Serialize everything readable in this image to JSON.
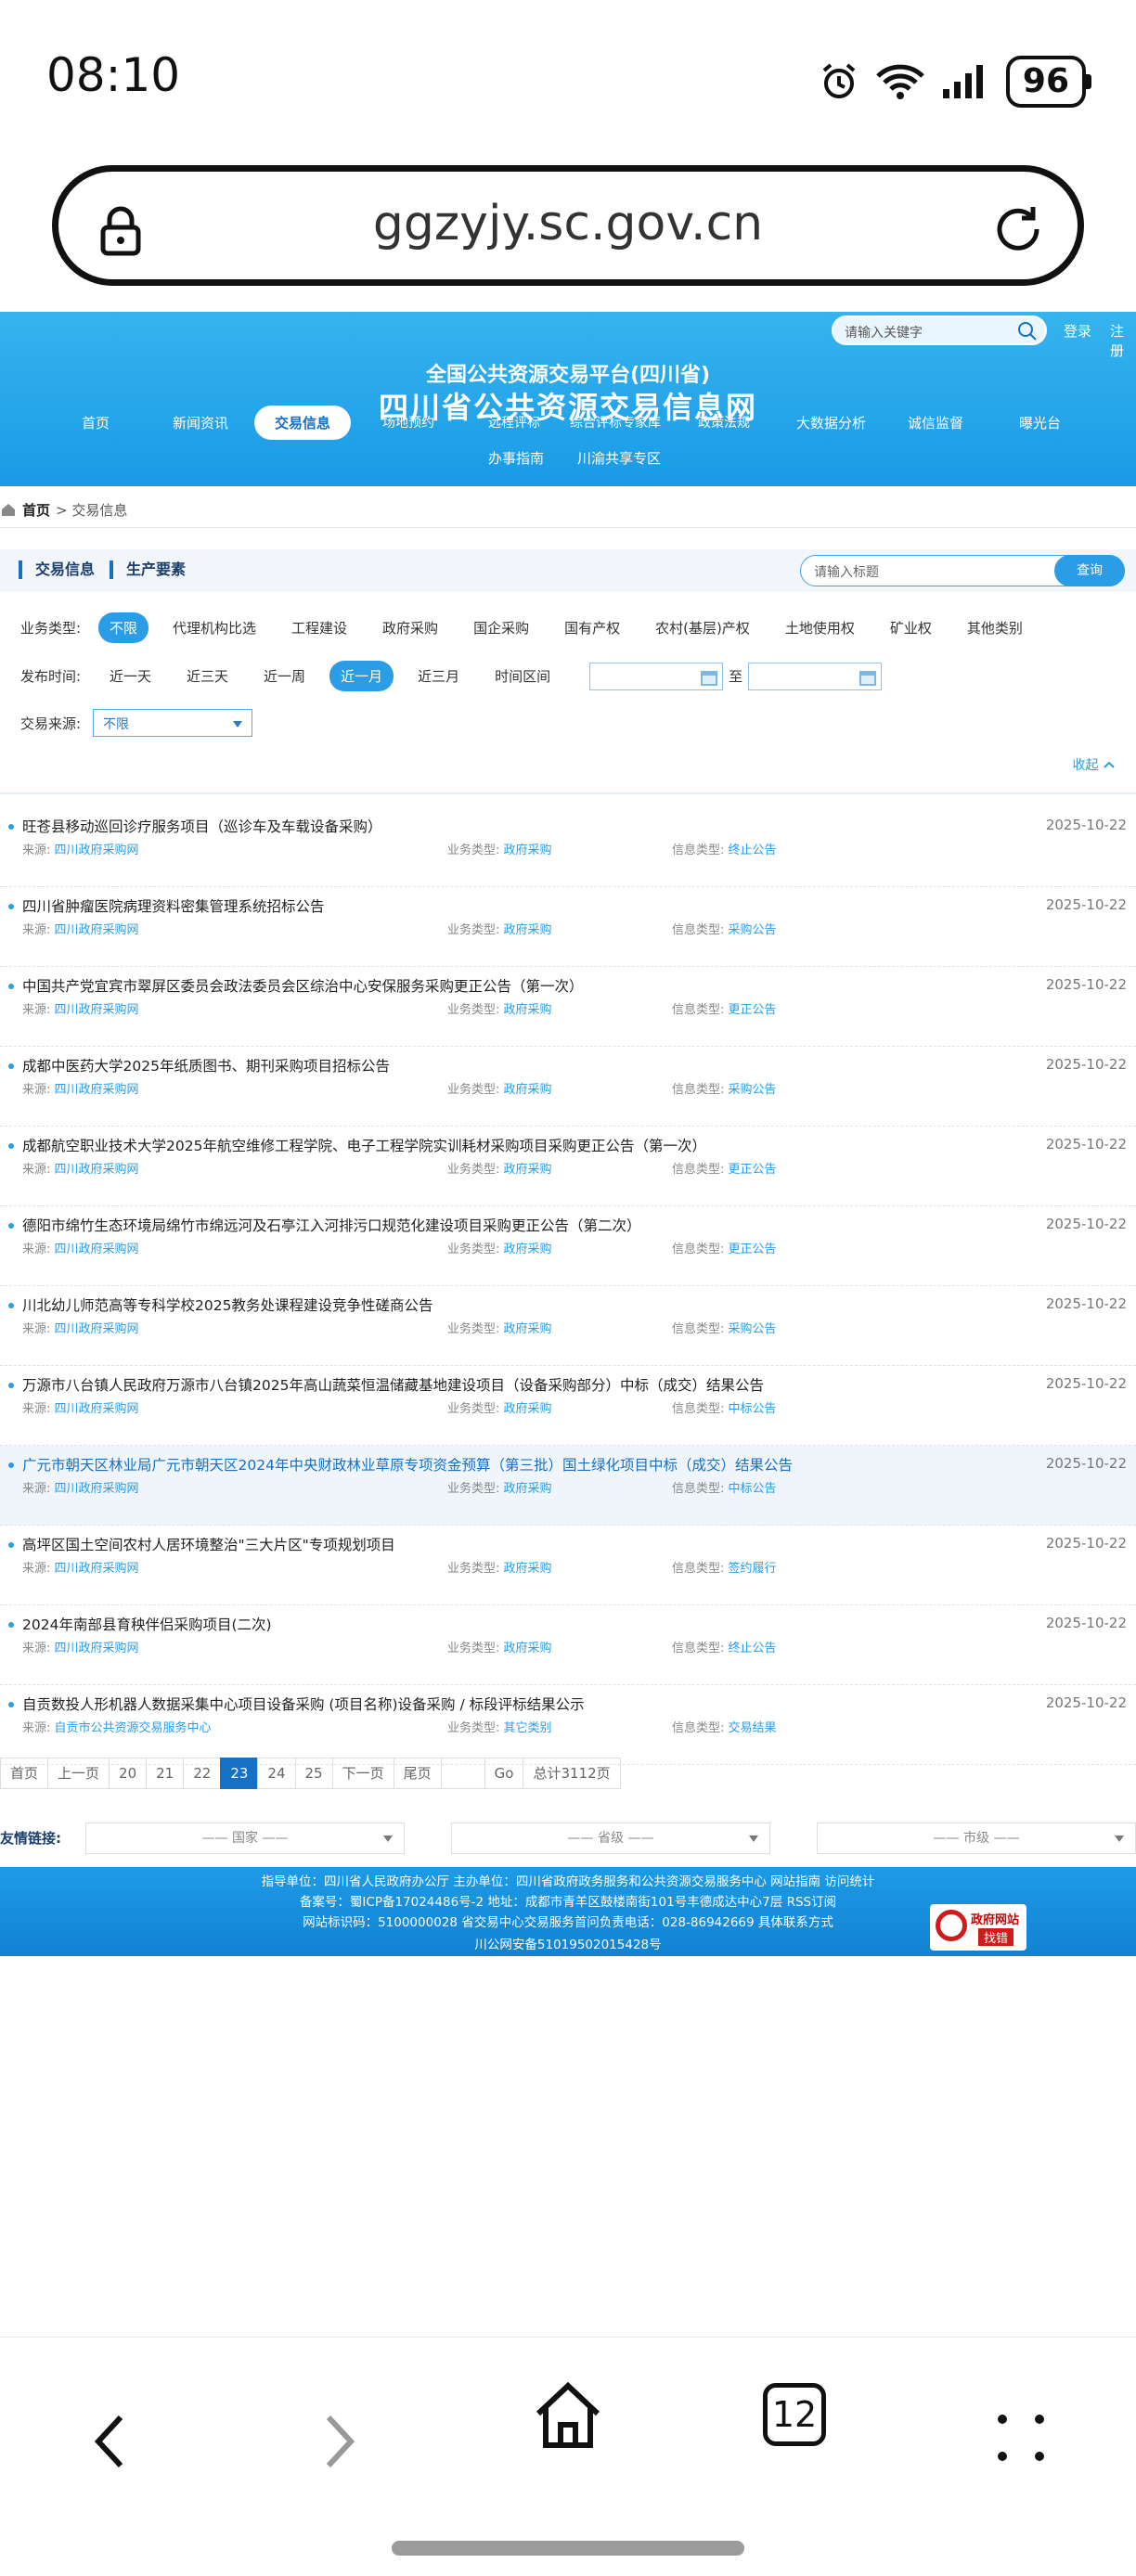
{
  "status": {
    "time": "08:10",
    "battery": "96"
  },
  "browser": {
    "url": "ggzyjy.sc.gov.cn",
    "tab_count": "12"
  },
  "header": {
    "subtitle": "全国公共资源交易平台(四川省)",
    "title": "四川省公共资源交易信息网",
    "search_placeholder": "请输入关键字",
    "login": "登录",
    "register": "注册",
    "nav": [
      "首页",
      "新闻资讯",
      "交易信息",
      "场地预约",
      "远程评标",
      "综合评标专家库",
      "政策法规",
      "大数据分析",
      "诚信监督",
      "曝光台",
      "办事指南",
      "川渝共享专区"
    ]
  },
  "breadcrumb": {
    "home": "首页",
    "current": "> 交易信息"
  },
  "filters": {
    "tabs": [
      "交易信息",
      "生产要素"
    ],
    "title_placeholder": "请输入标题",
    "search_button": "查询",
    "business_label": "业务类型:",
    "business_types": [
      "不限",
      "代理机构比选",
      "工程建设",
      "政府采购",
      "国企采购",
      "国有产权",
      "农村(基层)产权",
      "土地使用权",
      "矿业权",
      "其他类别"
    ],
    "time_label": "发布时间:",
    "time_options": [
      "近一天",
      "近三天",
      "近一周",
      "近一月",
      "近三月",
      "时间区间"
    ],
    "range_to": "至",
    "source_label": "交易来源:",
    "source_value": "不限",
    "collapse": "收起"
  },
  "list": {
    "source_label": "来源:",
    "biz_label": "业务类型:",
    "info_label": "信息类型:",
    "items": [
      {
        "title": "旺苍县移动巡回诊疗服务项目（巡诊车及车载设备采购）",
        "date": "2025-10-22",
        "source": "四川政府采购网",
        "biz": "政府采购",
        "info": "终止公告"
      },
      {
        "title": "四川省肿瘤医院病理资料密集管理系统招标公告",
        "date": "2025-10-22",
        "source": "四川政府采购网",
        "biz": "政府采购",
        "info": "采购公告"
      },
      {
        "title": "中国共产党宜宾市翠屏区委员会政法委员会区综治中心安保服务采购更正公告（第一次）",
        "date": "2025-10-22",
        "source": "四川政府采购网",
        "biz": "政府采购",
        "info": "更正公告"
      },
      {
        "title": "成都中医药大学2025年纸质图书、期刊采购项目招标公告",
        "date": "2025-10-22",
        "source": "四川政府采购网",
        "biz": "政府采购",
        "info": "采购公告"
      },
      {
        "title": "成都航空职业技术大学2025年航空维修工程学院、电子工程学院实训耗材采购项目采购更正公告（第一次）",
        "date": "2025-10-22",
        "source": "四川政府采购网",
        "biz": "政府采购",
        "info": "更正公告"
      },
      {
        "title": "德阳市绵竹生态环境局绵竹市绵远河及石亭江入河排污口规范化建设项目采购更正公告（第二次）",
        "date": "2025-10-22",
        "source": "四川政府采购网",
        "biz": "政府采购",
        "info": "更正公告"
      },
      {
        "title": "川北幼儿师范高等专科学校2025教务处课程建设竞争性磋商公告",
        "date": "2025-10-22",
        "source": "四川政府采购网",
        "biz": "政府采购",
        "info": "采购公告"
      },
      {
        "title": "万源市八台镇人民政府万源市八台镇2025年高山蔬菜恒温储藏基地建设项目（设备采购部分）中标（成交）结果公告",
        "date": "2025-10-22",
        "source": "四川政府采购网",
        "biz": "政府采购",
        "info": "中标公告"
      },
      {
        "title": "广元市朝天区林业局广元市朝天区2024年中央财政林业草原专项资金预算（第三批）国土绿化项目中标（成交）结果公告",
        "date": "2025-10-22",
        "source": "四川政府采购网",
        "biz": "政府采购",
        "info": "中标公告"
      },
      {
        "title": "高坪区国土空间农村人居环境整治\"三大片区\"专项规划项目",
        "date": "2025-10-22",
        "source": "四川政府采购网",
        "biz": "政府采购",
        "info": "签约履行"
      },
      {
        "title": "2024年南部县育秧伴侣采购项目(二次)",
        "date": "2025-10-22",
        "source": "四川政府采购网",
        "biz": "政府采购",
        "info": "终止公告"
      },
      {
        "title": "自贡数投人形机器人数据采集中心项目设备采购 (项目名称)设备采购 / 标段评标结果公示",
        "date": "2025-10-22",
        "source": "自贡市公共资源交易服务中心",
        "biz": "其它类别",
        "info": "交易结果"
      }
    ]
  },
  "pager": {
    "first": "首页",
    "prev": "上一页",
    "pages": [
      "20",
      "21",
      "22",
      "23",
      "24",
      "25"
    ],
    "current": "23",
    "next": "下一页",
    "last": "尾页",
    "go": "Go",
    "total": "总计3112页"
  },
  "links": {
    "label": "友情链接:",
    "national": "—— 国家 ——",
    "provincial": "—— 省级 ——",
    "city": "—— 市级 ——"
  },
  "footer": {
    "line1": "指导单位：四川省人民政府办公厅    主办单位：四川省政府政务服务和公共资源交易服务中心    网站指南    访问统计",
    "line2": "备案号：蜀ICP备17024486号-2   地址：成都市青羊区鼓楼南街101号丰德成达中心7层   RSS订阅",
    "line3": "网站标识码：5100000028    省交易中心交易服务首问负责电话：028-86942669    具体联系方式",
    "line4": "川公网安备51019502015428号",
    "gov_top": "政府网站",
    "gov_bottom": "找错"
  }
}
